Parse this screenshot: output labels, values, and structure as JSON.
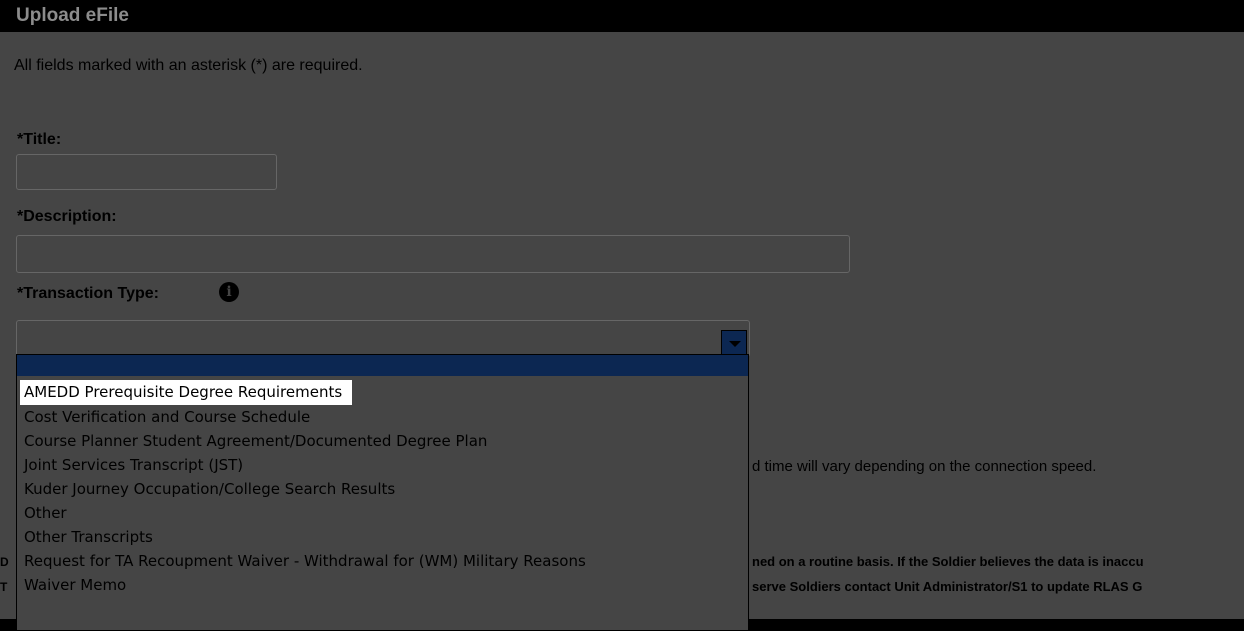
{
  "header": {
    "title": "Upload eFile"
  },
  "form": {
    "required_note": "All fields marked with an asterisk (*) are required.",
    "title_label": "*Title:",
    "description_label": "*Description:",
    "transaction_label": "*Transaction Type:",
    "title_value": "",
    "description_value": "",
    "transaction_value": ""
  },
  "dropdown": {
    "options": [
      "AMEDD Prerequisite Degree Requirements",
      "Cost Verification and Course Schedule",
      "Course Planner Student Agreement/Documented Degree Plan",
      "Joint Services Transcript (JST)",
      "Kuder Journey Occupation/College Search Results",
      "Other",
      "Other Transcripts",
      "Request for TA Recoupment Waiver - Withdrawal for (WM) Military Reasons",
      "Waiver Memo"
    ],
    "highlighted_index": 0
  },
  "background": {
    "upload_note": "d time will vary depending on the connection speed.",
    "disclaimer_1": "ned on a routine basis. If the Soldier believes the data is inaccu",
    "disclaimer_2": "serve Soldiers contact Unit Administrator/S1 to update RLAS G",
    "left_fragment_1": "D",
    "left_fragment_2": "T"
  }
}
